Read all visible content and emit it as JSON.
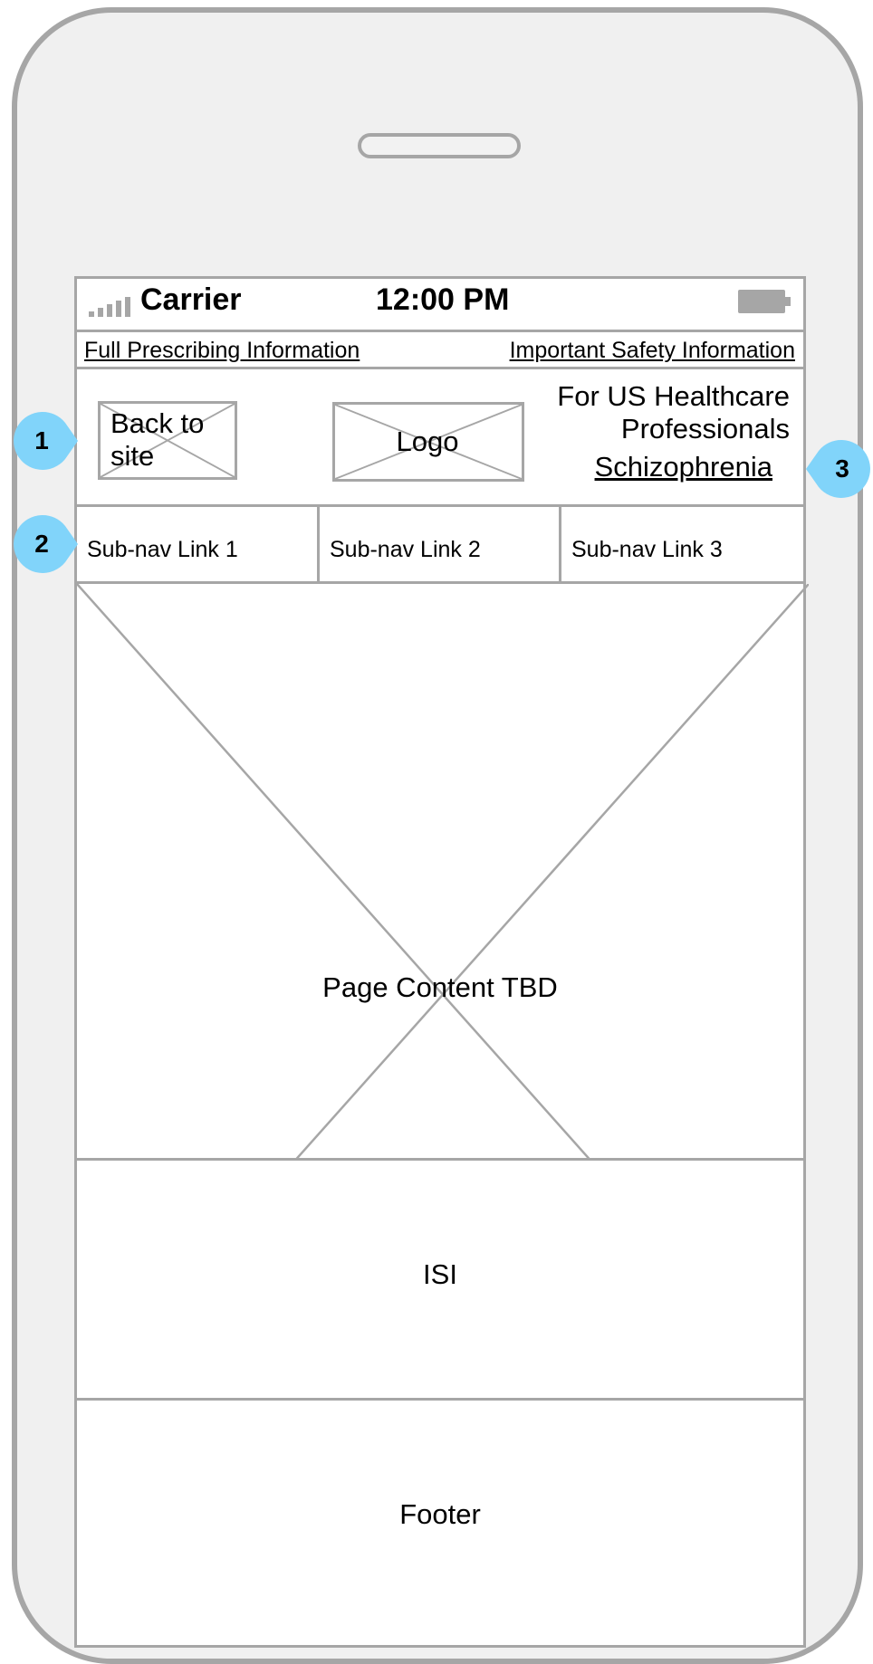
{
  "status_bar": {
    "carrier": "Carrier",
    "time": "12:00 PM"
  },
  "top_links": {
    "prescribing": "Full Prescribing Information",
    "safety": "Important Safety Information"
  },
  "header": {
    "back_to_site": "Back to site",
    "logo": "Logo",
    "audience_line1": "For US Healthcare",
    "audience_line2": "Professionals",
    "indication_link": "Schizophrenia"
  },
  "subnav": [
    "Sub-nav Link 1",
    "Sub-nav Link 2",
    "Sub-nav Link 3"
  ],
  "content": {
    "label": "Page Content TBD"
  },
  "isi": {
    "label": "ISI"
  },
  "footer": {
    "label": "Footer"
  },
  "callouts": [
    "1",
    "2",
    "3"
  ],
  "colors": {
    "wireframe_gray": "#a6a6a6",
    "callout_blue": "#81d4fa",
    "phone_body": "#f0f0f0"
  }
}
